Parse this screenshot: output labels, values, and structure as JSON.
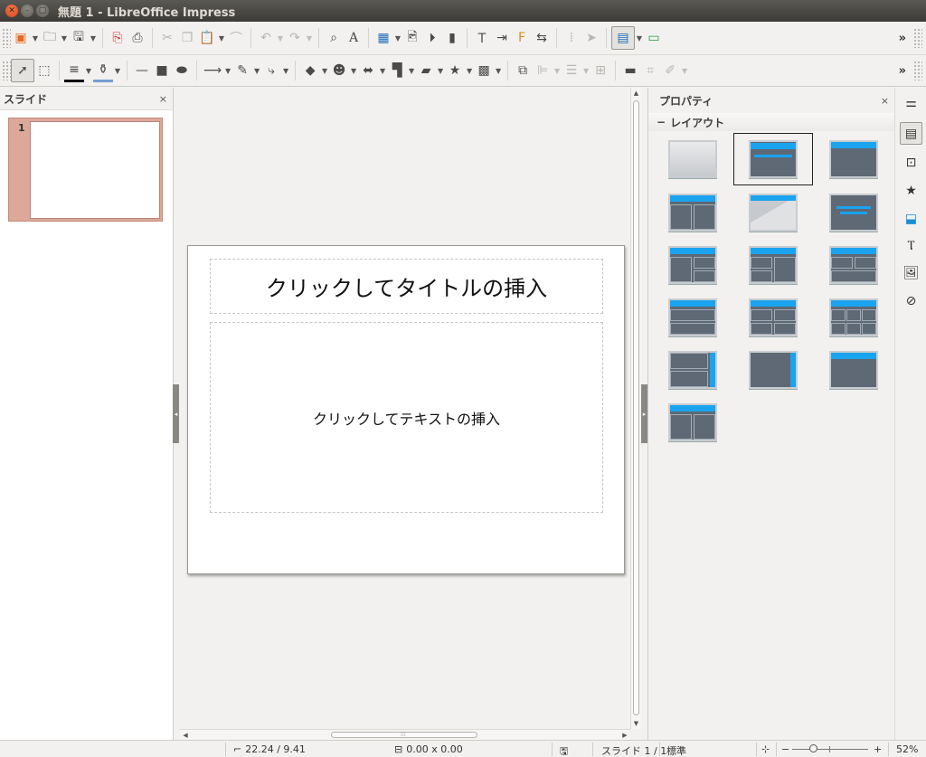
{
  "window": {
    "title": "無題 1 - LibreOffice Impress"
  },
  "toolbar1": {
    "icons": [
      "slideshow-icon",
      "open-icon",
      "save-icon",
      "export-pdf-icon",
      "print-icon",
      "cut-icon",
      "copy-icon",
      "paste-icon",
      "clone-format-icon",
      "undo-icon",
      "redo-icon",
      "find-replace-icon",
      "spelling-icon",
      "table-icon",
      "image-icon",
      "media-icon",
      "chart-icon",
      "textbox-icon",
      "special-character-icon",
      "fontwork-icon",
      "transitions-icon",
      "grid-icon",
      "helplines-icon",
      "display-views-icon",
      "master-slide-icon"
    ],
    "more": "»"
  },
  "toolbar2": {
    "icons": [
      "select-icon",
      "zoom-pan-icon",
      "line-color-icon",
      "fill-color-icon",
      "line-icon",
      "rectangle-icon",
      "ellipse-icon",
      "arrow-line-icon",
      "curve-icon",
      "connector-icon",
      "basic-shapes-icon",
      "symbol-shapes-icon",
      "block-arrows-icon",
      "flowchart-icon",
      "callouts-icon",
      "stars-icon",
      "3d-objects-icon",
      "rotate-icon",
      "align-icon",
      "arrange-icon",
      "distribute-icon",
      "shadow-icon",
      "crop-icon",
      "filter-icon"
    ],
    "more": "»"
  },
  "slides_pane": {
    "title": "スライド",
    "close": "×",
    "thumbnails": [
      {
        "number": "1"
      }
    ]
  },
  "slide": {
    "title_placeholder": "クリックしてタイトルの挿入",
    "body_placeholder": "クリックしてテキストの挿入"
  },
  "properties": {
    "title": "プロパティ",
    "close": "×",
    "section_layout": "レイアウト",
    "section_toggle": "−",
    "layouts": [
      "blank-slide",
      "title-content",
      "title-only",
      "title-2-content",
      "centered-text",
      "title-only-centered",
      "title-content-2-content",
      "title-2-content-content",
      "title-2-content-over-content",
      "title-content-over-content",
      "title-4-content",
      "title-6-content",
      "vertical-title-text",
      "vertical-title-text-chart",
      "vertical-title",
      "vertical-title-2-content"
    ],
    "selected_layout": "title-content"
  },
  "deck": {
    "tabs": [
      "properties-tab",
      "slide-transition-tab",
      "animation-tab",
      "master-slides-tab",
      "styles-tab",
      "gallery-tab",
      "navigator-tab"
    ]
  },
  "status": {
    "position": "22.24 / 9.41",
    "size": "0.00 x 0.00",
    "slide": "スライド 1 / 1",
    "layout": "標準",
    "zoom_minus": "−",
    "zoom_plus": "+",
    "zoom": "52%"
  }
}
